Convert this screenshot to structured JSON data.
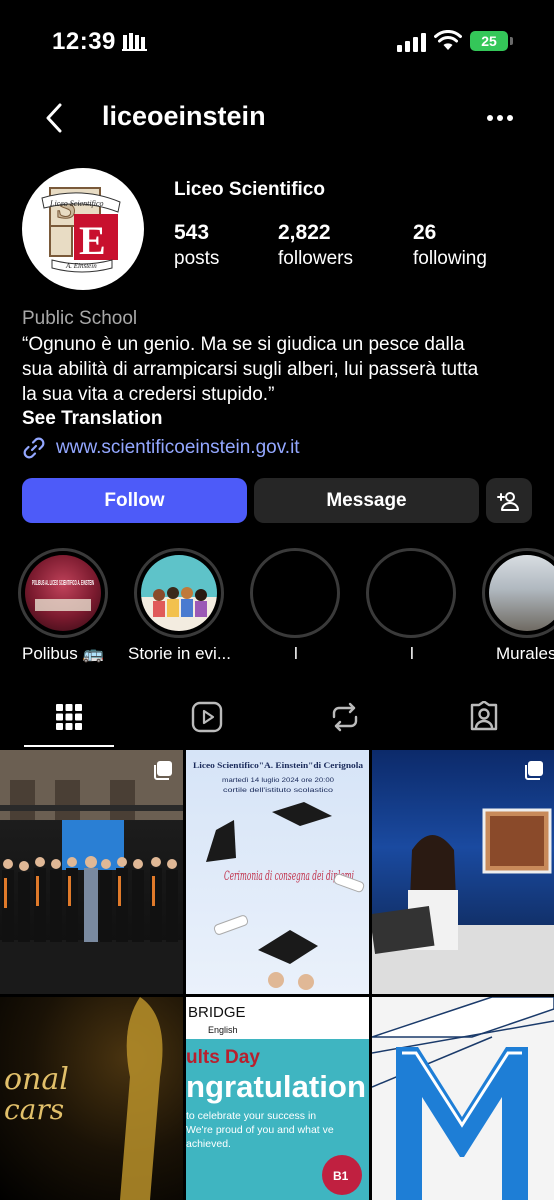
{
  "status_bar": {
    "time": "12:39",
    "battery": "25"
  },
  "header": {
    "username": "liceoeinstein"
  },
  "profile": {
    "display_name": "Liceo Scientifico",
    "avatar_text_top": "Liceo Scientifico",
    "avatar_text_bottom": "A. Einstein",
    "stats": [
      {
        "value": "543",
        "label": "posts"
      },
      {
        "value": "2,822",
        "label": "followers"
      },
      {
        "value": "26",
        "label": "following"
      }
    ],
    "category": "Public School",
    "bio_lines": [
      "“Ognuno è un genio. Ma se si giudica un pesce dalla",
      "sua abilità di arrampicarsi sugli alberi, lui passerà tutta",
      "la sua vita a credersi stupido.”"
    ],
    "see_translation": "See Translation",
    "link": "www.scientificoeinstein.gov.it"
  },
  "actions": {
    "follow": "Follow",
    "message": "Message"
  },
  "highlights": [
    {
      "label": "Polibus 🚌",
      "cover_text": "POLIBUS AL LICEO SCIENTIFICO A. EINSTEIN"
    },
    {
      "label": "Storie in evi..."
    },
    {
      "label": "l"
    },
    {
      "label": "l"
    },
    {
      "label": "Murales"
    }
  ],
  "tabs": [
    "grid",
    "reels",
    "reposts",
    "tagged"
  ],
  "posts": {
    "p2_title": "Liceo Scientifico\"A. Einstein\"di Cerignola",
    "p2_date": "martedì 14 luglio 2024 ore 20:00",
    "p2_place": "cortile dell'istituto scolastico",
    "p2_script": "Cerimonia di consegna dei diplomi",
    "p4_text1": "onal",
    "p4_text2": "cars",
    "p5_brand": "BRIDGE",
    "p5_brand_sub": "English",
    "p5_day": "ults Day",
    "p5_congrats": "ngratulation",
    "p5_body": "to celebrate your success in We're proud of you and what ve achieved.",
    "p5_badge": "B1"
  },
  "colors": {
    "accent": "#4d5bf9",
    "link": "#93a7ff",
    "battery": "#34c759"
  }
}
